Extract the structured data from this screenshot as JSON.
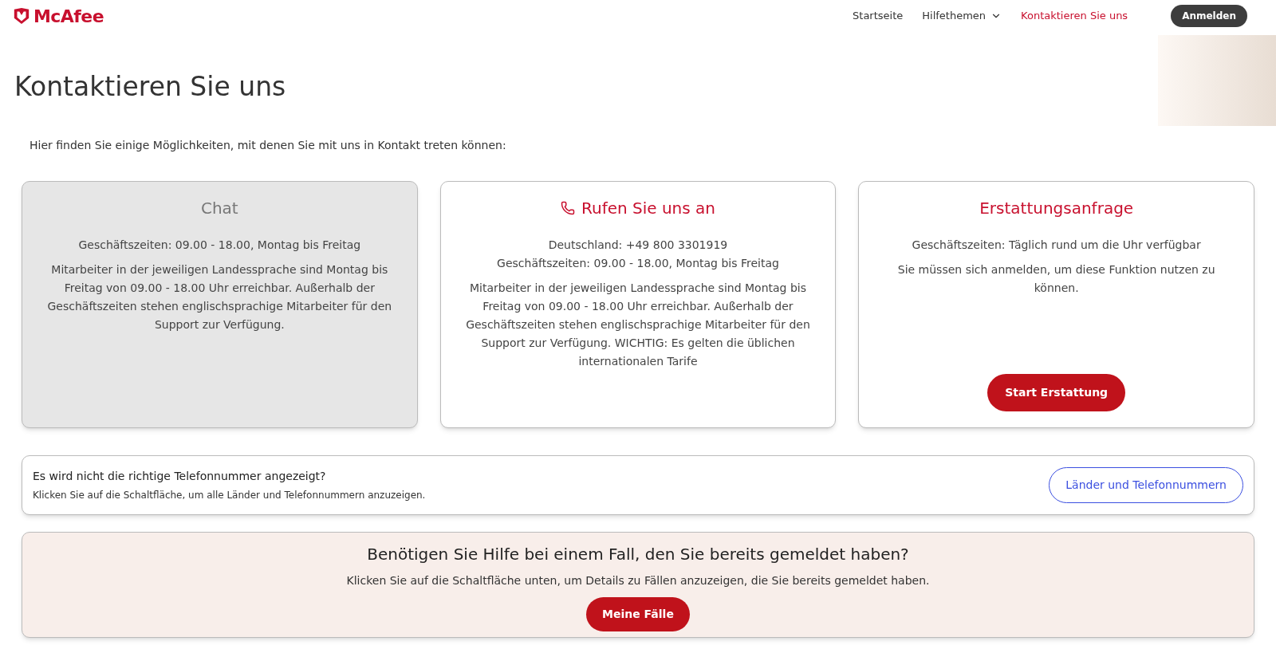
{
  "header": {
    "logo": "McAfee",
    "nav": [
      {
        "label": "Startseite",
        "selected": false,
        "dropdown": false
      },
      {
        "label": "Hilfethemen",
        "selected": false,
        "dropdown": true
      },
      {
        "label": "Kontaktieren Sie uns",
        "selected": true,
        "dropdown": false
      }
    ],
    "login_button": "Anmelden"
  },
  "page_title": "Kontaktieren Sie uns",
  "intro": "Hier finden Sie einige Möglichkeiten, mit denen Sie mit uns in Kontakt treten können:",
  "cards": [
    {
      "kind": "chat",
      "title": "Chat",
      "disabled": true,
      "lines": [
        "Geschäftszeiten: 09.00 - 18.00, Montag bis Freitag"
      ],
      "paragraphs": [
        "Mitarbeiter in der jeweiligen Landessprache sind Montag bis Freitag von 09.00 - 18.00 Uhr erreichbar. Außerhalb der Geschäftszeiten stehen englischsprachige Mitarbeiter für den Support zur Verfügung."
      ]
    },
    {
      "kind": "phone",
      "title": "Rufen Sie uns an",
      "disabled": false,
      "lines": [
        "Deutschland: +49 800 3301919",
        "Geschäftszeiten: 09.00 - 18.00, Montag bis Freitag"
      ],
      "paragraphs": [
        "Mitarbeiter in der jeweiligen Landessprache sind Montag bis Freitag von 09.00 - 18.00 Uhr erreichbar. Außerhalb der Geschäftszeiten stehen englischsprachige Mitarbeiter für den Support zur Verfügung. WICHTIG: Es gelten die üblichen internationalen Tarife"
      ]
    },
    {
      "kind": "refund",
      "title": "Erstattungsanfrage",
      "disabled": false,
      "lines": [
        "Geschäftszeiten: Täglich rund um die Uhr verfügbar"
      ],
      "paragraphs": [
        "Sie müssen sich anmelden, um diese Funktion nutzen zu können."
      ],
      "button": "Start Erstattung"
    }
  ],
  "phone_banner": {
    "heading": "Es wird nicht die richtige Telefonnummer angezeigt?",
    "text": "Klicken Sie auf die Schaltfläche, um alle Länder und Telefonnummern anzuzeigen.",
    "button": "Länder und Telefonnummern"
  },
  "cases_banner": {
    "heading": "Benötigen Sie Hilfe bei einem Fall, den Sie bereits gemeldet haben?",
    "text": "Klicken Sie auf die Schaltfläche unten, um Details zu Fällen anzuzeigen, die Sie bereits gemeldet haben.",
    "button": "Meine Fälle"
  }
}
